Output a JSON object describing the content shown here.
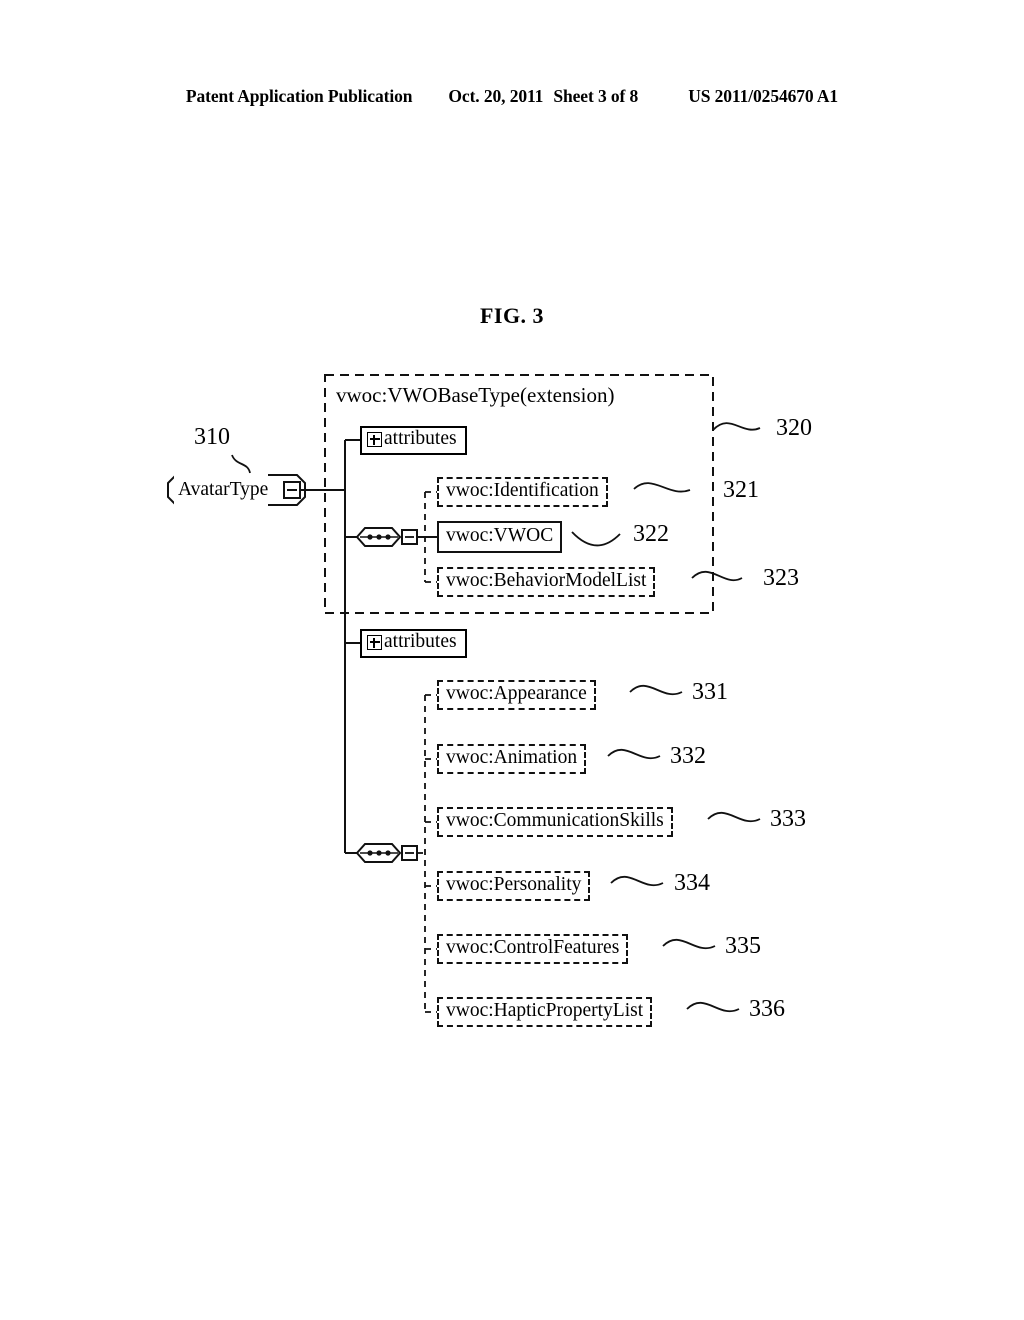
{
  "header": {
    "publication": "Patent Application Publication",
    "date": "Oct. 20, 2011",
    "sheet": "Sheet 3 of 8",
    "number": "US 2011/0254670 A1"
  },
  "figure": {
    "title": "FIG. 3",
    "root": {
      "label": "AvatarType",
      "ref": "310",
      "collapse_control": "minus"
    },
    "extension_group": {
      "label": "vwoc:VWOBaseType(extension)",
      "ref": "320",
      "border": "dashed",
      "attributes": {
        "label": "attributes",
        "expand_control": "plus"
      },
      "sequence_connector": "sequence-icon",
      "children": [
        {
          "label": "vwoc:Identification",
          "ref": "321",
          "required": false
        },
        {
          "label": "vwoc:VWOC",
          "ref": "322",
          "required": true
        },
        {
          "label": "vwoc:BehaviorModelList",
          "ref": "323",
          "required": false
        }
      ]
    },
    "own_group": {
      "attributes": {
        "label": "attributes",
        "expand_control": "plus"
      },
      "sequence_connector": "sequence-icon",
      "children": [
        {
          "label": "vwoc:Appearance",
          "ref": "331",
          "required": false
        },
        {
          "label": "vwoc:Animation",
          "ref": "332",
          "required": false
        },
        {
          "label": "vwoc:CommunicationSkills",
          "ref": "333",
          "required": false
        },
        {
          "label": "vwoc:Personality",
          "ref": "334",
          "required": false
        },
        {
          "label": "vwoc:ControlFeatures",
          "ref": "335",
          "required": false
        },
        {
          "label": "vwoc:HapticPropertyList",
          "ref": "336",
          "required": false
        }
      ]
    }
  },
  "colors": {
    "ink": "#000000",
    "paper": "#ffffff"
  }
}
